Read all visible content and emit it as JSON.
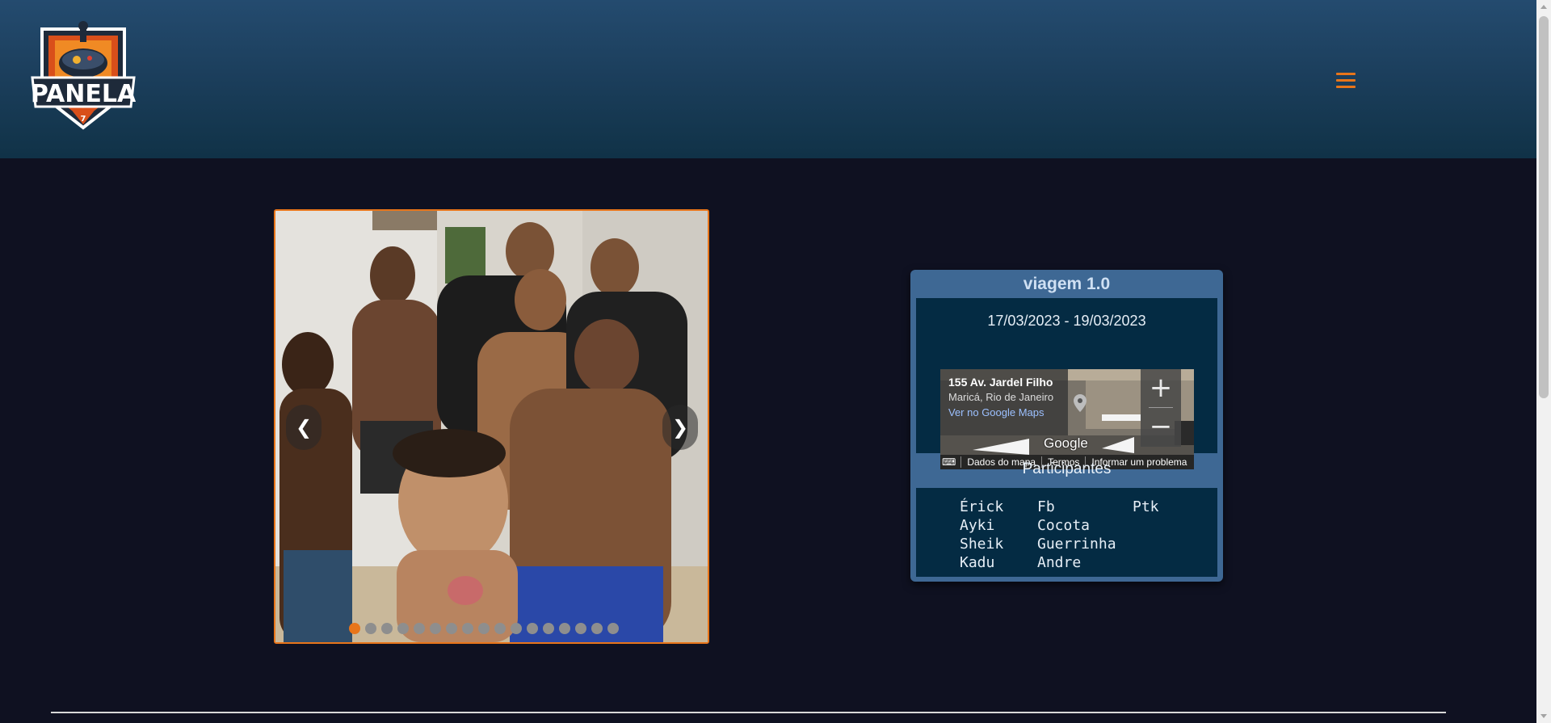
{
  "header": {
    "logo_text": "PANELA",
    "logo_number": "7",
    "menu_icon": "hamburger-menu-icon",
    "accent_color": "#e8751a"
  },
  "carousel": {
    "prev_label": "❮",
    "next_label": "❯",
    "slide_count": 17,
    "active_index": 0
  },
  "trip": {
    "title": "viagem 1.0",
    "dates": "17/03/2023 - 19/03/2023",
    "map": {
      "address": "155 Av. Jardel Filho",
      "city": "Maricá, Rio de Janeiro",
      "link": "Ver no Google Maps",
      "logo": "Google",
      "footer": [
        "Dados do mapa",
        "Termos",
        "Informar um problema"
      ]
    },
    "participants_title": "Participantes",
    "participants_columns": [
      [
        "Érick",
        "Ayki",
        "Sheik",
        "Kadu"
      ],
      [
        "Fb",
        "Cocota",
        "Guerrinha",
        "Andre"
      ],
      [
        "Ptk"
      ]
    ]
  }
}
